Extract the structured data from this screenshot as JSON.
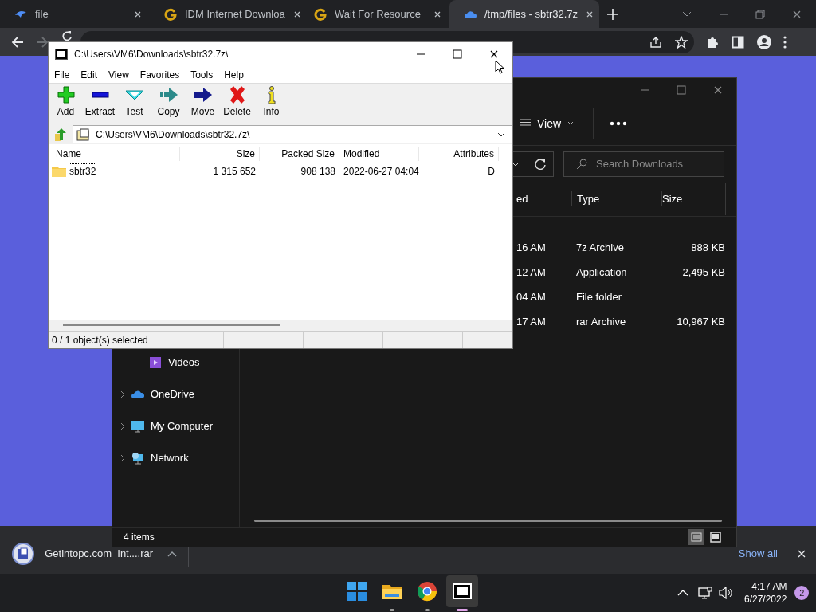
{
  "browser": {
    "tabs": [
      {
        "title": "file",
        "kind": "bird",
        "selected": false
      },
      {
        "title": "IDM Internet Downloa",
        "kind": "g",
        "selected": false
      },
      {
        "title": "Wait For Resource",
        "kind": "g",
        "selected": false
      },
      {
        "title": "/tmp/files - sbtr32.7z",
        "kind": "cloud",
        "selected": true
      }
    ]
  },
  "archiver": {
    "title": "C:\\Users\\VM6\\Downloads\\sbtr32.7z\\",
    "menu": [
      "File",
      "Edit",
      "View",
      "Favorites",
      "Tools",
      "Help"
    ],
    "tools": [
      {
        "label": "Add",
        "kind": "add"
      },
      {
        "label": "Extract",
        "kind": "extract"
      },
      {
        "label": "Test",
        "kind": "test"
      },
      {
        "label": "Copy",
        "kind": "copy"
      },
      {
        "label": "Move",
        "kind": "move"
      },
      {
        "label": "Delete",
        "kind": "delete"
      },
      {
        "label": "Info",
        "kind": "info"
      }
    ],
    "path": "C:\\Users\\VM6\\Downloads\\sbtr32.7z\\",
    "columns": [
      "Name",
      "Size",
      "Packed Size",
      "Modified",
      "Attributes"
    ],
    "rows": [
      {
        "cells": [
          "sbtr32",
          "1 315 652",
          "908 138",
          "2022-06-27 04:04",
          "D"
        ],
        "focused": true
      }
    ],
    "status": "0 / 1 object(s) selected"
  },
  "explorer": {
    "view_button": "View",
    "search": {
      "placeholder": "Search Downloads"
    },
    "columns": [
      "ed",
      "Type",
      "Size"
    ],
    "rows": [
      [
        "16 AM",
        "7z Archive",
        "888 KB"
      ],
      [
        "12 AM",
        "Application",
        "2,495 KB"
      ],
      [
        "04 AM",
        "File folder",
        ""
      ],
      [
        "17 AM",
        "rar Archive",
        "10,967 KB"
      ]
    ],
    "nav": [
      {
        "label": "Videos",
        "kind": "videos",
        "expandable": false
      },
      {
        "label": "OneDrive",
        "kind": "cloud",
        "expandable": true
      },
      {
        "label": "My Computer",
        "kind": "computer",
        "expandable": true
      },
      {
        "label": "Network",
        "kind": "network",
        "expandable": true
      }
    ],
    "status": "4 items",
    "views": [
      {
        "kind": "details",
        "selected": true
      },
      {
        "kind": "tiles",
        "selected": false
      }
    ]
  },
  "downloads": {
    "file": "_Getintopc.com_Int....rar",
    "show_all": "Show all"
  },
  "taskbar": {
    "apps": [
      {
        "kind": "start",
        "running": false,
        "active": false
      },
      {
        "kind": "folder",
        "running": true,
        "active": false
      },
      {
        "kind": "chrome",
        "running": true,
        "active": false
      },
      {
        "kind": "archiver",
        "running": true,
        "active": true
      }
    ],
    "time": "4:17 AM",
    "date": "6/27/2022",
    "notifications": "2"
  }
}
